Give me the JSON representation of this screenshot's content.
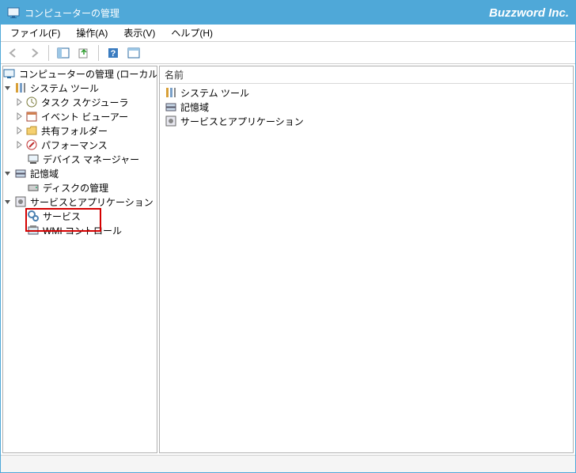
{
  "titlebar": {
    "title": "コンピューターの管理",
    "brand": "Buzzword Inc."
  },
  "menu": {
    "file": "ファイル(F)",
    "action": "操作(A)",
    "view": "表示(V)",
    "help": "ヘルプ(H)"
  },
  "tree": {
    "root": "コンピューターの管理 (ローカル)",
    "systemTools": "システム ツール",
    "taskScheduler": "タスク スケジューラ",
    "eventViewer": "イベント ビューアー",
    "sharedFolders": "共有フォルダー",
    "performance": "パフォーマンス",
    "deviceManager": "デバイス マネージャー",
    "storage": "記憶域",
    "diskMgmt": "ディスクの管理",
    "servicesApps": "サービスとアプリケーション",
    "services": "サービス",
    "wmiControl": "WMI コントロール"
  },
  "list": {
    "headerName": "名前",
    "items": {
      "systemTools": "システム ツール",
      "storage": "記憶域",
      "servicesApps": "サービスとアプリケーション"
    }
  }
}
